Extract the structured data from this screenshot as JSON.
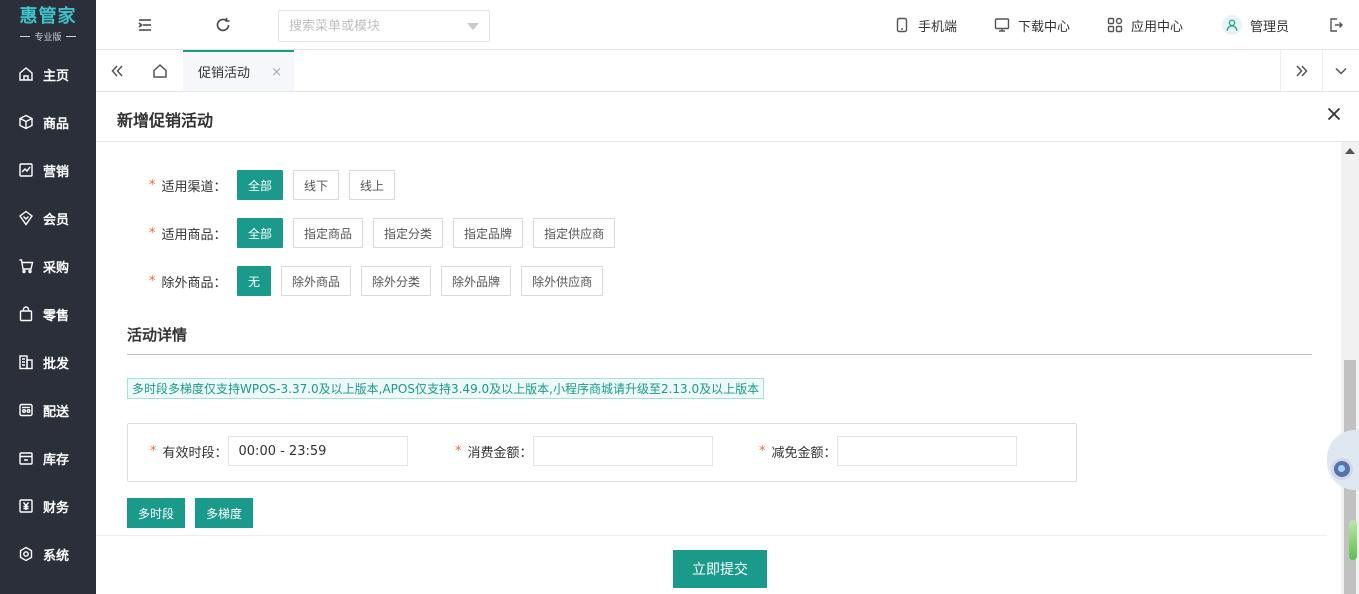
{
  "app": {
    "logo_main": "惠管家",
    "logo_sub": "专业版"
  },
  "sidebar": {
    "items": [
      {
        "label": "主页",
        "icon": "home-icon"
      },
      {
        "label": "商品",
        "icon": "box-icon"
      },
      {
        "label": "营销",
        "icon": "chart-icon"
      },
      {
        "label": "会员",
        "icon": "member-icon"
      },
      {
        "label": "采购",
        "icon": "cart-icon"
      },
      {
        "label": "零售",
        "icon": "bag-icon"
      },
      {
        "label": "批发",
        "icon": "building-icon"
      },
      {
        "label": "配送",
        "icon": "truck-icon"
      },
      {
        "label": "库存",
        "icon": "warehouse-icon"
      },
      {
        "label": "财务",
        "icon": "finance-icon"
      },
      {
        "label": "系统",
        "icon": "settings-icon"
      }
    ]
  },
  "topbar": {
    "search_placeholder": "搜索菜单或模块",
    "mobile_label": "手机端",
    "download_label": "下载中心",
    "apps_label": "应用中心",
    "user_label": "管理员"
  },
  "tabs": {
    "active_label": "促销活动",
    "close_glyph": "×"
  },
  "panel": {
    "title": "新增促销活动",
    "rows": [
      {
        "label": "适用渠道：",
        "options": [
          "全部",
          "线下",
          "线上"
        ],
        "active": 0
      },
      {
        "label": "适用商品：",
        "options": [
          "全部",
          "指定商品",
          "指定分类",
          "指定品牌",
          "指定供应商"
        ],
        "active": 0
      },
      {
        "label": "除外商品：",
        "options": [
          "无",
          "除外商品",
          "除外分类",
          "除外品牌",
          "除外供应商"
        ],
        "active": 0
      }
    ],
    "section_title": "活动详情",
    "notice": "多时段多梯度仅支持WPOS-3.37.0及以上版本,APOS仅支持3.49.0及以上版本,小程序商城请升级至2.13.0及以上版本",
    "time_label": "有效时段：",
    "time_value": "00:00 - 23:59",
    "amount_label": "消费金额：",
    "amount_value": "",
    "discount_label": "减免金额：",
    "discount_value": "",
    "multi_period_label": "多时段",
    "multi_tier_label": "多梯度",
    "submit_label": "立即提交",
    "required_mark": "*"
  },
  "colors": {
    "accent": "#1a9a8b",
    "sidebar_bg": "#2b2f3a",
    "required": "#e86a3a"
  }
}
